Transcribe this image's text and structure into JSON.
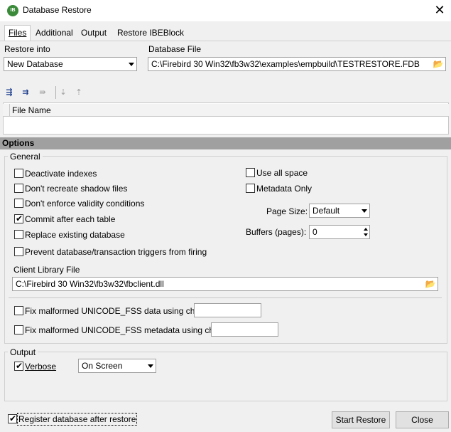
{
  "window": {
    "title": "Database Restore",
    "icon_text": "IB",
    "close_glyph": "✕"
  },
  "tabs": [
    {
      "label": "Files"
    },
    {
      "label": "Additional"
    },
    {
      "label": "Output"
    },
    {
      "label": "Restore IBEBlock"
    }
  ],
  "files": {
    "restore_into_label": "Restore into",
    "restore_into_value": "New Database",
    "database_file_label": "Database File",
    "database_file_value": "C:\\Firebird 30 Win32\\fb3w32\\examples\\empbuild\\TESTRESTORE.FDB"
  },
  "toolbar": {
    "icons": [
      "add-file-icon",
      "insert-file-icon",
      "delete-file-icon",
      "move-down-icon",
      "move-up-icon"
    ]
  },
  "grid": {
    "column_file_name": "File Name"
  },
  "options": {
    "bar_label": "Options",
    "general_label": "General",
    "checkboxes_left": [
      {
        "label": "Deactivate indexes",
        "checked": false
      },
      {
        "label": "Don't recreate shadow files",
        "checked": false
      },
      {
        "label": "Don't enforce validity conditions",
        "checked": false
      },
      {
        "label": "Commit after each table",
        "checked": true
      },
      {
        "label": "Replace existing database",
        "checked": false
      },
      {
        "label": "Prevent database/transaction triggers from firing",
        "checked": false
      }
    ],
    "checkboxes_right": [
      {
        "label": "Use all space",
        "checked": false
      },
      {
        "label": "Metadata Only",
        "checked": false
      }
    ],
    "page_size_label": "Page Size:",
    "page_size_value": "Default",
    "buffers_label": "Buffers (pages):",
    "buffers_value": "0",
    "client_library_label": "Client Library File",
    "client_library_value": "C:\\Firebird 30 Win32\\fb3w32\\fbclient.dll",
    "fix_data_label": "Fix malformed UNICODE_FSS data using charset",
    "fix_data_checked": false,
    "fix_data_value": "",
    "fix_metadata_label": "Fix malformed UNICODE_FSS metadata using charset",
    "fix_metadata_checked": false,
    "fix_metadata_value": ""
  },
  "output": {
    "group_label": "Output",
    "verbose_label": "Verbose",
    "verbose_checked": true,
    "verbose_target": "On Screen"
  },
  "footer": {
    "register_label": "Register database after restore",
    "register_checked": true,
    "start_button": "Start Restore",
    "close_button": "Close"
  }
}
